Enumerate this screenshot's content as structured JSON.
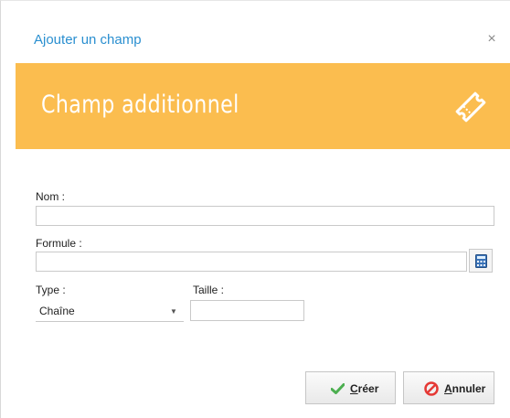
{
  "dialog": {
    "title": "Ajouter un champ",
    "close_glyph": "×"
  },
  "banner": {
    "title": "Champ additionnel",
    "icon": "ticket-icon",
    "background_color": "#fbbd4f"
  },
  "form": {
    "nom_label": "Nom :",
    "nom_value": "",
    "formule_label": "Formule :",
    "formule_value": "",
    "calculator_icon": "calculator-icon",
    "type_label": "Type :",
    "type_value": "Chaîne",
    "taille_label": "Taille :",
    "taille_value": ""
  },
  "buttons": {
    "create_label": "Créer",
    "create_icon": "checkmark-icon",
    "cancel_label": "Annuler",
    "cancel_icon": "cancel-icon"
  },
  "colors": {
    "title": "#2a8fd0",
    "accent": "#fbbd4f",
    "check": "#4caf50",
    "cancel": "#e53935"
  }
}
